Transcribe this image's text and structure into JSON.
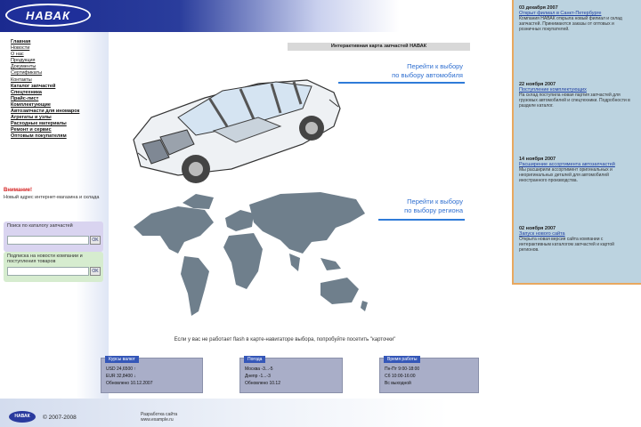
{
  "header": {
    "logo_text": "НАВАК"
  },
  "nav": {
    "items": [
      {
        "label": "Главная",
        "bold": true
      },
      {
        "label": "Новости"
      },
      {
        "label": "О нас"
      },
      {
        "label": "Продукция"
      },
      {
        "label": "Документы"
      },
      {
        "label": "Сертификаты"
      },
      {
        "label": "Контакты"
      },
      {
        "label": "Каталог запчастей",
        "bold": true
      },
      {
        "label": "Спецтехника",
        "bold": true
      },
      {
        "label": "Прайс-лист",
        "bold": true
      },
      {
        "label": "Комплектующие",
        "bold": true
      },
      {
        "label": "Автозапчасти для иномарок",
        "bold": true
      },
      {
        "label": "Агрегаты и узлы",
        "bold": true
      },
      {
        "label": "Расходные материалы",
        "bold": true
      },
      {
        "label": "Ремонт и сервис",
        "bold": true
      },
      {
        "label": "Оптовым покупателям",
        "bold": true
      }
    ]
  },
  "red_block": {
    "title": "Внимание!",
    "text": "Новый адрес интернет-магазина и склада"
  },
  "search_box": {
    "label": "Поиск по каталогу запчастей",
    "button": "OK"
  },
  "subscribe_box": {
    "label": "Подписка на новости компании и поступления товаров",
    "button": "OK"
  },
  "main": {
    "title": "Интерактивная карта запчастей НАВАК",
    "link_cars": [
      "Перейти к выбору",
      "по выбору автомобиля"
    ],
    "link_regions": [
      "Перейти к выбору",
      "по выбору региона"
    ],
    "bottom_text": "Если у вас не работает flash в карте-навигаторе выбора, попробуйте посетить \"карточки\""
  },
  "widgets": [
    {
      "header": "Курсы валют",
      "lines": [
        "USD 24,6500 ↑",
        "EUR 32,8400 ↓",
        "Обновлено 10.12.2007"
      ]
    },
    {
      "header": "Погода",
      "lines": [
        "Москва -3...-5",
        "Днепр -1...-3",
        "Обновлено 10.12"
      ]
    },
    {
      "header": "Время работы",
      "lines": [
        "Пн-Пт 9:00-18:00",
        "Сб 10:00-16:00",
        "Вс выходной"
      ]
    }
  ],
  "footer": {
    "logo": "НАВАК",
    "copyright": "© 2007-2008",
    "developer": [
      "Разработка сайта",
      "www.example.ru"
    ]
  },
  "news": [
    {
      "date": "03 декабря 2007",
      "title": "Открыт филиал в Санкт-Петербурге",
      "text": "Компания НАВАК открыла новый филиал и склад запчастей. Принимаются заказы от оптовых и розничных покупателей."
    },
    {
      "date": "22 ноября 2007",
      "title": "Поступление комплектующих",
      "text": "На склад поступила новая партия запчастей для грузовых автомобилей и спецтехники. Подробности в разделе каталог."
    },
    {
      "date": "14 ноября 2007",
      "title": "Расширение ассортимента автозапчастей",
      "text": "Мы расширили ассортимент оригинальных и неоригинальных деталей для автомобилей иностранного производства."
    },
    {
      "date": "02 ноября 2007",
      "title": "Запуск нового сайта",
      "text": "Открыта новая версия сайта компании с интерактивным каталогом запчастей и картой регионов."
    }
  ]
}
